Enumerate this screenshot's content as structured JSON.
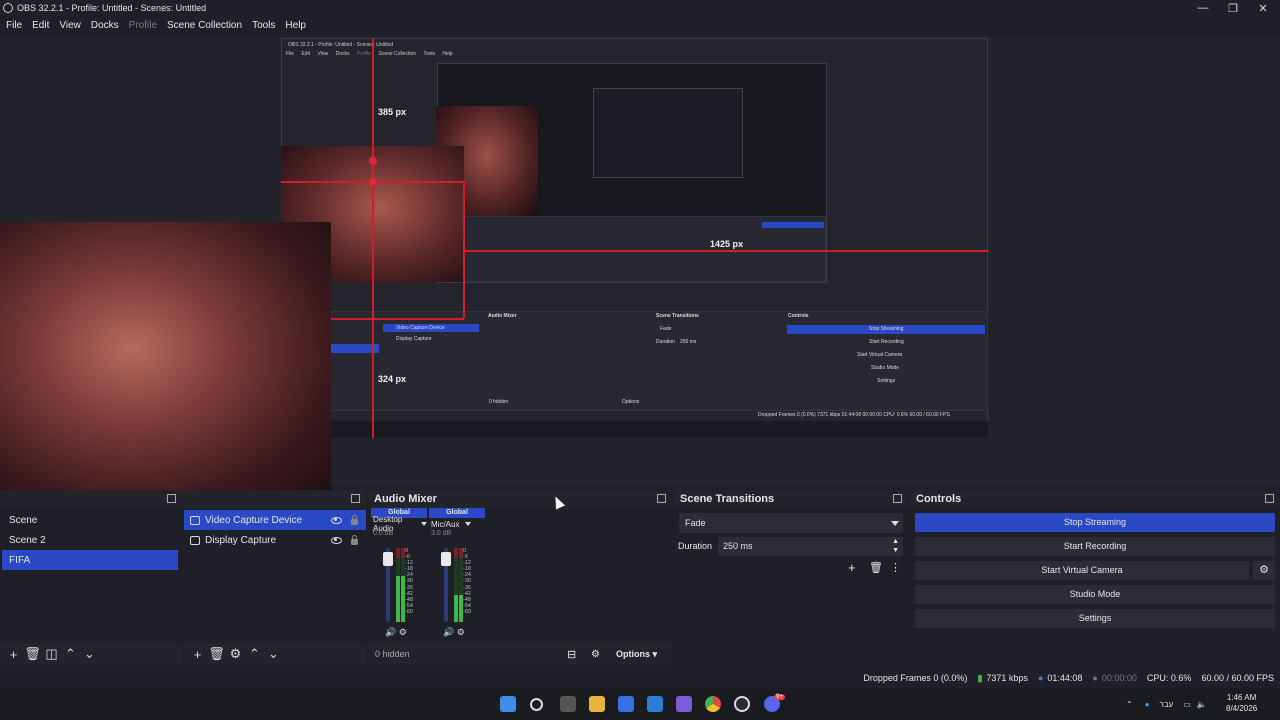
{
  "window": {
    "title": "OBS 32.2.1 - Profile: Untitled - Scenes: Untitled"
  },
  "menu": [
    "File",
    "Edit",
    "View",
    "Docks",
    "Profile",
    "Scene Collection",
    "Tools",
    "Help"
  ],
  "preview": {
    "label_385": "385 px",
    "label_1425": "1425 px",
    "label_324": "324 px",
    "inner_title": "OBS 32.2.1 - Profile: Untitled - Scenes: Untitled",
    "inner_menu": [
      "File",
      "Edit",
      "View",
      "Docks",
      "Profile",
      "Scene Collection",
      "Tools",
      "Help"
    ],
    "mini_sources": [
      "Video Capture Device",
      "Display Capture"
    ],
    "mini_mixer_title": "Audio Mixer",
    "mini_transitions_title": "Scene Transitions",
    "mini_controls_title": "Controls",
    "mini_fade": "Fade",
    "mini_duration": "Duration",
    "mini_duration_value": "250 ms",
    "mini_controls": [
      "Stop Streaming",
      "Start Recording",
      "Start Virtual Camera",
      "Studio Mode",
      "Settings"
    ],
    "mini_hidden": "0 hidden",
    "mini_options": "Options",
    "mini_status": "Dropped Frames 0 (0.0%)   7371 kbps   01:44:08   00:00:00   CPU: 0.6%   60.00 / 60.00 FPS"
  },
  "scenes": {
    "items": [
      {
        "label": "Scene",
        "selected": false
      },
      {
        "label": "Scene 2",
        "selected": false
      },
      {
        "label": "FIFA",
        "selected": true
      }
    ]
  },
  "sources": {
    "items": [
      {
        "label": "Video Capture Device",
        "selected": true
      },
      {
        "label": "Display Capture",
        "selected": false
      }
    ]
  },
  "audio_mixer": {
    "title": "Audio Mixer",
    "channels": [
      {
        "tag": "Global",
        "name": "Desktop Audio",
        "db": "0.0 dB",
        "level": 0.62
      },
      {
        "tag": "Global",
        "name": "Mic/Aux",
        "db": "3.0 dB",
        "level": 0.36
      }
    ],
    "scale": [
      "0",
      "-6",
      "-12",
      "-18",
      "-24",
      "-30",
      "-36",
      "-42",
      "-48",
      "-54",
      "-60"
    ],
    "hidden_count": "0 hidden",
    "options_label": "Options"
  },
  "transitions": {
    "title": "Scene Transitions",
    "selected": "Fade",
    "duration_label": "Duration",
    "duration_value": "250 ms"
  },
  "controls": {
    "title": "Controls",
    "stop_streaming": "Stop Streaming",
    "start_recording": "Start Recording",
    "start_virtual_camera": "Start Virtual Camera",
    "studio_mode": "Studio Mode",
    "settings": "Settings"
  },
  "status": {
    "dropped_frames": "Dropped Frames 0 (0.0%)",
    "bitrate": "7371 kbps",
    "stream_time": "01:44:08",
    "record_time": "00:00:00",
    "cpu": "CPU: 0.6%",
    "fps": "60.00 / 60.00 FPS"
  },
  "taskbar": {
    "language": "עבר",
    "time": "1:46 AM",
    "date": "8/4/2026",
    "badge": "9+"
  },
  "colors": {
    "accent": "#2b48c5",
    "red_guide": "#d11e2a",
    "meter_green": "#3fb84a",
    "bg": "#1e1f29"
  }
}
